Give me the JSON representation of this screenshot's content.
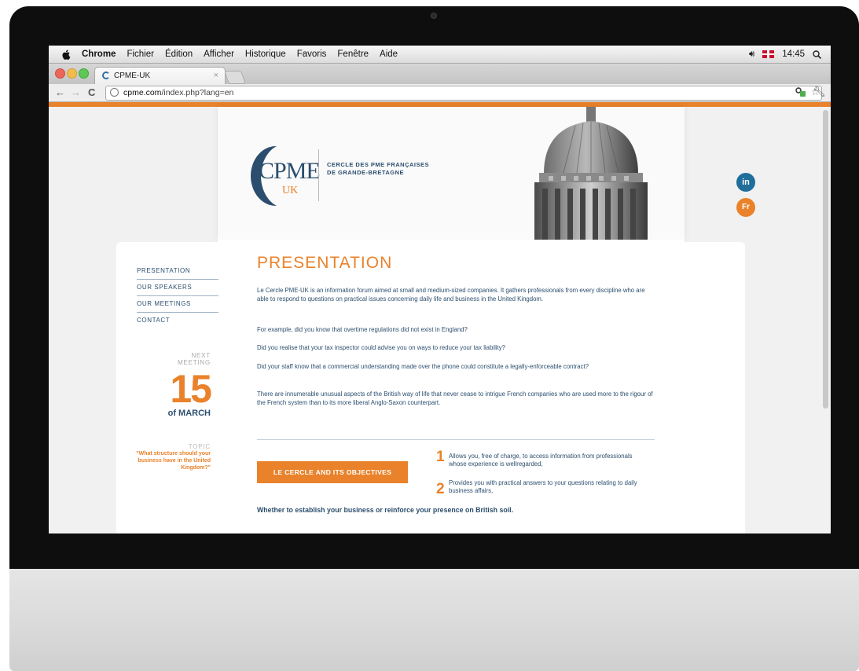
{
  "menubar": {
    "app_name": "Chrome",
    "menus": [
      "Fichier",
      "Édition",
      "Afficher",
      "Historique",
      "Favoris",
      "Fenêtre",
      "Aide"
    ],
    "clock": "14:45"
  },
  "browser": {
    "tab_title": "CPME-UK",
    "tab_close": "×",
    "url_host": "cpme.com",
    "url_path": "/index.php?lang=en"
  },
  "site": {
    "logo_text": "CPME",
    "logo_sub": "UK",
    "tagline_line1": "CERCLE DES PME FRANÇAISES",
    "tagline_line2": "DE GRANDE-BRETAGNE",
    "social_linkedin": "in",
    "social_fr": "Fr",
    "nav": [
      "PRESENTATION",
      "OUR SPEAKERS",
      "OUR MEETINGS",
      "CONTACT"
    ],
    "next_meeting_label_1": "NEXT",
    "next_meeting_label_2": "MEETING",
    "next_meeting_day": "15",
    "next_meeting_month": "of MARCH",
    "topic_label": "TOPIC",
    "topic_text": "\"What structure should your business have in the United Kingdom?\"",
    "title": "PRESENTATION",
    "paragraphs": [
      "Le Cercle PME-UK is an information forum aimed at small and medium-sized companies. It gathers professionals from every discipline who are able to respond to questions on practical issues concerning daily life and business in the United Kingdom.",
      "For example, did you know that overtime regulations did not exist in England?",
      "Did you realise that your tax inspector could advise you on ways to reduce your tax liability?",
      "Did your staff know that a commercial understanding made over the phone could constitute a legally-enforceable contract?",
      "There are innumerable unusual aspects of the British way of life that never cease to intrigue French companies who are used more to the rigour of the French system than to its more liberal Anglo-Saxon counterpart."
    ],
    "cta_label": "LE CERCLE AND ITS OBJECTIVES",
    "objectives": [
      {
        "num": "1",
        "text": "Allows you, free of charge, to access information from professionals whose experience is wellregarded,"
      },
      {
        "num": "2",
        "text": "Provides you with practical answers to your questions relating to daily business affairs,"
      }
    ],
    "closing": "Whether to establish your business or reinforce your presence on British soil."
  },
  "colors": {
    "accent_orange": "#e9822a",
    "brand_navy": "#2b4e6e",
    "linkedin_blue": "#1f6e9c"
  }
}
